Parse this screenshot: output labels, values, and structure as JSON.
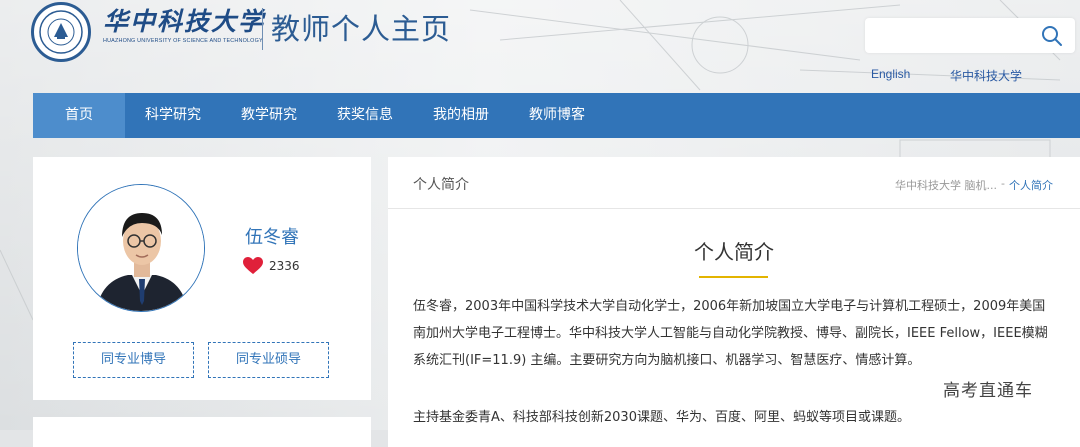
{
  "header": {
    "school_name_cn": "华中科技大学",
    "school_name_en": "HUAZHONG UNIVERSITY OF SCIENCE AND TECHNOLOGY",
    "site_title": "教师个人主页",
    "search_placeholder": "",
    "links": {
      "english": "English",
      "university": "华中科技大学"
    }
  },
  "nav": {
    "items": [
      {
        "label": "首页",
        "active": true
      },
      {
        "label": "科学研究"
      },
      {
        "label": "教学研究"
      },
      {
        "label": "获奖信息"
      },
      {
        "label": "我的相册"
      },
      {
        "label": "教师博客"
      }
    ]
  },
  "profile": {
    "name": "伍冬睿",
    "likes": "2336",
    "buttons": {
      "phd": "同专业博导",
      "master": "同专业硕导"
    }
  },
  "main": {
    "panel_title": "个人简介",
    "breadcrumb": {
      "parent": "华中科技大学 脑机...",
      "separator": "-",
      "current": "个人简介"
    },
    "section_title": "个人简介",
    "paragraphs": [
      "伍冬睿，2003年中国科学技术大学自动化学士，2006年新加坡国立大学电子与计算机工程硕士，2009年美国南加州大学电子工程博士。华中科技大学人工智能与自动化学院教授、博导、副院长，IEEE Fellow，IEEE模糊系统汇刊(IF=11.9) 主编。主要研究方向为脑机接口、机器学习、智慧医疗、情感计算。",
      "主持基金委青A、科技部科技创新2030课题、华为、百度、阿里、蚂蚁等项目或课题。"
    ]
  },
  "watermark": "高考直通车",
  "colors": {
    "primary": "#3174b8",
    "active_nav": "#4d8dcc",
    "accent_underline": "#e3b400",
    "logo_blue": "#1f4c86"
  }
}
